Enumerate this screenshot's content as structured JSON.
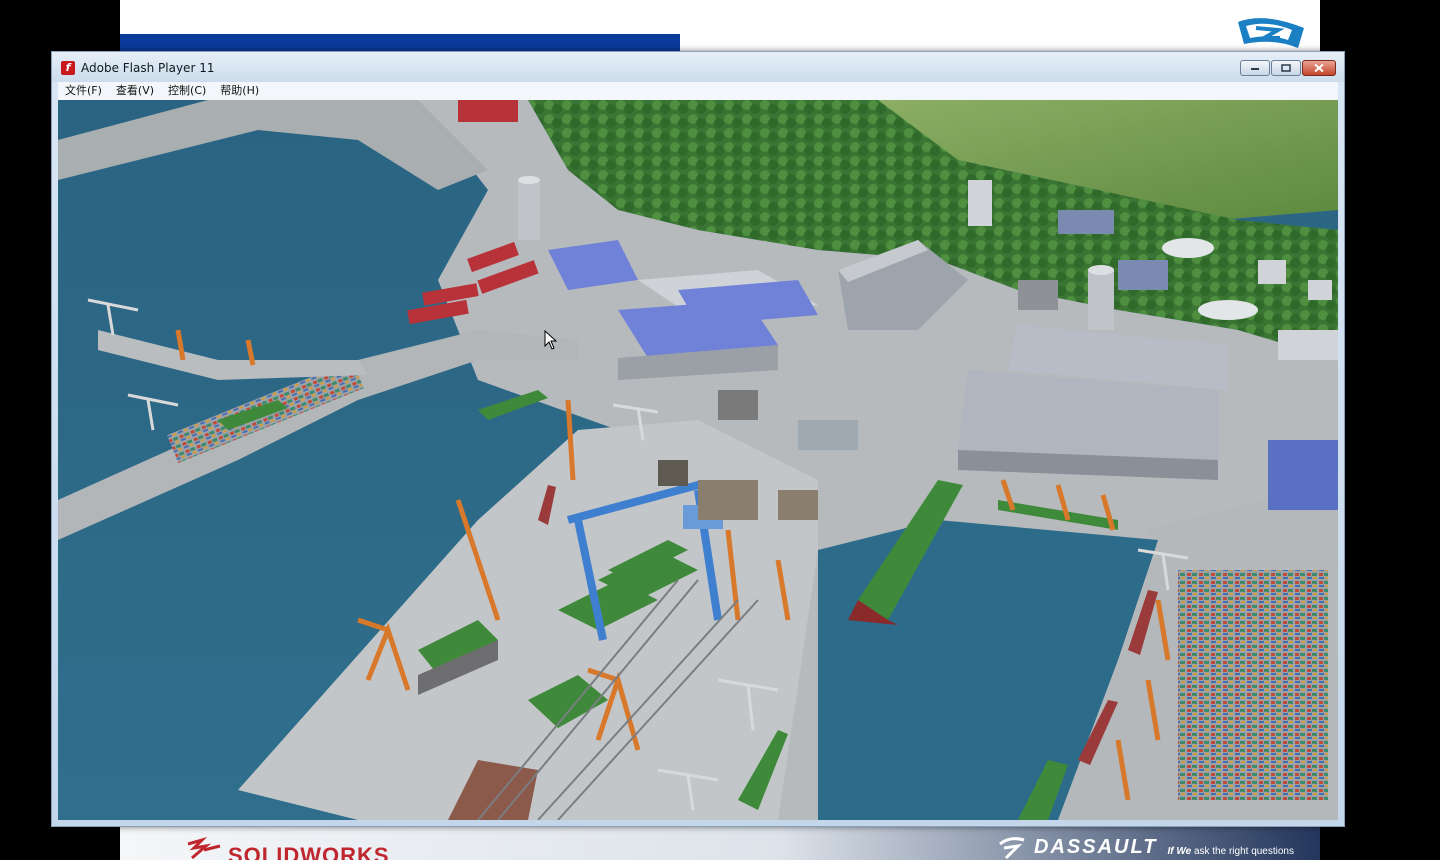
{
  "window": {
    "title": "Adobe Flash Player 11",
    "icon": "flash-player-icon",
    "controls": [
      "minimize-icon",
      "maximize-icon",
      "close-icon"
    ]
  },
  "menu": {
    "items": [
      {
        "label": "文件(F)"
      },
      {
        "label": "查看(V)"
      },
      {
        "label": "控制(C)"
      },
      {
        "label": "帮助(H)"
      }
    ]
  },
  "slide": {
    "footer_left_logo": "SOLIDWORKS",
    "footer_right_logo": "DASSAULT",
    "footer_tagline_bold": "If We",
    "footer_tagline": "ask the right questions"
  },
  "content": {
    "description_icon": "shipyard-scene",
    "colors": {
      "water": "#2e6a8c",
      "pier": "#b9bdc0",
      "roof_blue": "#6f82d8",
      "roof_red": "#b8323a",
      "crane_orange": "#d7782a",
      "gantry_blue": "#3f7fd0",
      "hull_green": "#3f8a3a",
      "forest": "#3d7a35"
    }
  }
}
